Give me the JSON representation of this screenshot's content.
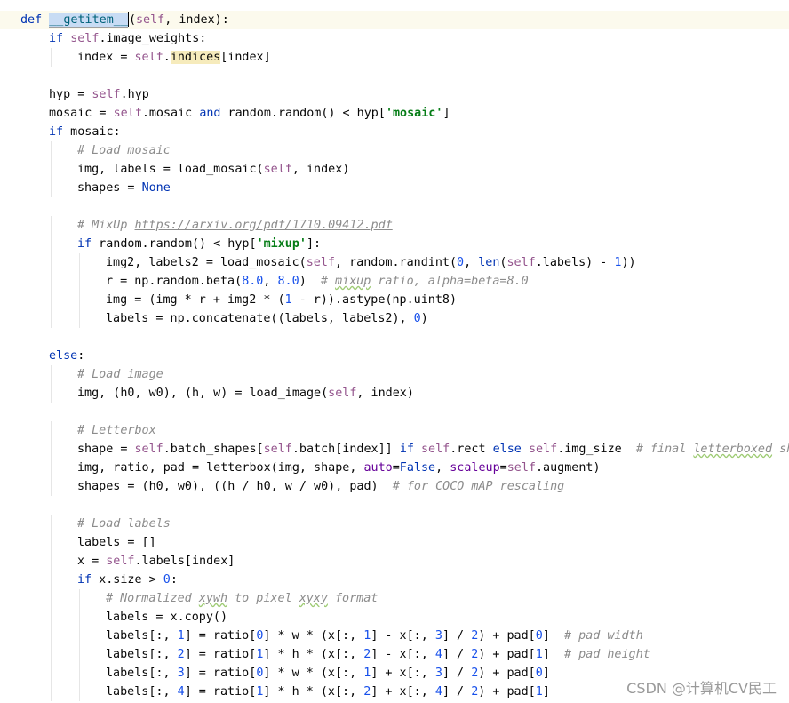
{
  "editor": {
    "lines": [
      [
        {
          "t": "def",
          "c": "kw"
        },
        {
          "t": " "
        },
        {
          "t": "__getitem__",
          "c": "fn-hl"
        },
        {
          "t": "",
          "c": "caret"
        },
        {
          "t": "("
        },
        {
          "t": "self",
          "c": "self"
        },
        {
          "t": ", index):"
        }
      ],
      [
        {
          "t": "if",
          "c": "kw"
        },
        {
          "t": " "
        },
        {
          "t": "self",
          "c": "self"
        },
        {
          "t": ".image_weights:"
        }
      ],
      [
        {
          "t": "index = "
        },
        {
          "t": "self",
          "c": "self"
        },
        {
          "t": "."
        },
        {
          "t": "indices",
          "c": "hl-warn"
        },
        {
          "t": "[index]"
        }
      ],
      [],
      [
        {
          "t": "hyp = "
        },
        {
          "t": "self",
          "c": "self"
        },
        {
          "t": ".hyp"
        }
      ],
      [
        {
          "t": "mosaic = "
        },
        {
          "t": "self",
          "c": "self"
        },
        {
          "t": ".mosaic "
        },
        {
          "t": "and",
          "c": "kw"
        },
        {
          "t": " random.random() < hyp["
        },
        {
          "t": "'mosaic'",
          "c": "str"
        },
        {
          "t": "]"
        }
      ],
      [
        {
          "t": "if",
          "c": "kw"
        },
        {
          "t": " mosaic:"
        }
      ],
      [
        {
          "t": "# Load mosaic",
          "c": "cm"
        }
      ],
      [
        {
          "t": "img, labels = load_mosaic("
        },
        {
          "t": "self",
          "c": "self"
        },
        {
          "t": ", index)"
        }
      ],
      [
        {
          "t": "shapes = "
        },
        {
          "t": "None",
          "c": "kw"
        }
      ],
      [],
      [
        {
          "t": "# MixUp ",
          "c": "cm"
        },
        {
          "t": "https://arxiv.org/pdf/1710.09412.pdf",
          "c": "url"
        }
      ],
      [
        {
          "t": "if",
          "c": "kw"
        },
        {
          "t": " random.random() < hyp["
        },
        {
          "t": "'mixup'",
          "c": "str"
        },
        {
          "t": "]:"
        }
      ],
      [
        {
          "t": "img2, labels2 = load_mosaic("
        },
        {
          "t": "self",
          "c": "self"
        },
        {
          "t": ", random.randint("
        },
        {
          "t": "0",
          "c": "num"
        },
        {
          "t": ", "
        },
        {
          "t": "len",
          "c": "kw"
        },
        {
          "t": "("
        },
        {
          "t": "self",
          "c": "self"
        },
        {
          "t": ".labels) - "
        },
        {
          "t": "1",
          "c": "num"
        },
        {
          "t": "))"
        }
      ],
      [
        {
          "t": "r = np.random.beta("
        },
        {
          "t": "8.0",
          "c": "num"
        },
        {
          "t": ", "
        },
        {
          "t": "8.0",
          "c": "num"
        },
        {
          "t": ")  "
        },
        {
          "t": "# ",
          "c": "cm"
        },
        {
          "t": "mixup",
          "c": "cm typo"
        },
        {
          "t": " ratio, alpha=beta=8.0",
          "c": "cm"
        }
      ],
      [
        {
          "t": "img = (img * r + img2 * ("
        },
        {
          "t": "1",
          "c": "num"
        },
        {
          "t": " - r)).astype(np.uint8)"
        }
      ],
      [
        {
          "t": "labels = np.concatenate((labels, labels2), "
        },
        {
          "t": "0",
          "c": "num"
        },
        {
          "t": ")"
        }
      ],
      [],
      [
        {
          "t": "else",
          "c": "kw"
        },
        {
          "t": ":"
        }
      ],
      [
        {
          "t": "# Load image",
          "c": "cm"
        }
      ],
      [
        {
          "t": "img, (h0, w0), (h, w) = load_image("
        },
        {
          "t": "self",
          "c": "self"
        },
        {
          "t": ", index)"
        }
      ],
      [],
      [
        {
          "t": "# Letterbox",
          "c": "cm"
        }
      ],
      [
        {
          "t": "shape = "
        },
        {
          "t": "self",
          "c": "self"
        },
        {
          "t": ".batch_shapes["
        },
        {
          "t": "self",
          "c": "self"
        },
        {
          "t": ".batch[index]] "
        },
        {
          "t": "if",
          "c": "kw"
        },
        {
          "t": " "
        },
        {
          "t": "self",
          "c": "self"
        },
        {
          "t": ".rect "
        },
        {
          "t": "else",
          "c": "kw"
        },
        {
          "t": " "
        },
        {
          "t": "self",
          "c": "self"
        },
        {
          "t": ".img_size  "
        },
        {
          "t": "# final ",
          "c": "cm"
        },
        {
          "t": "letterboxed",
          "c": "cm typo"
        },
        {
          "t": " sh",
          "c": "cm"
        }
      ],
      [
        {
          "t": "img, ratio, pad = letterbox(img, shape, "
        },
        {
          "t": "auto",
          "c": "kwarg"
        },
        {
          "t": "="
        },
        {
          "t": "False",
          "c": "kw"
        },
        {
          "t": ", "
        },
        {
          "t": "scaleup",
          "c": "kwarg"
        },
        {
          "t": "="
        },
        {
          "t": "self",
          "c": "self"
        },
        {
          "t": ".augment)"
        }
      ],
      [
        {
          "t": "shapes = (h0, w0), ((h / h0, w / w0), pad)  "
        },
        {
          "t": "# for COCO mAP rescaling",
          "c": "cm"
        }
      ],
      [],
      [
        {
          "t": "# Load labels",
          "c": "cm"
        }
      ],
      [
        {
          "t": "labels = []"
        }
      ],
      [
        {
          "t": "x = "
        },
        {
          "t": "self",
          "c": "self"
        },
        {
          "t": ".labels[index]"
        }
      ],
      [
        {
          "t": "if",
          "c": "kw"
        },
        {
          "t": " x.size > "
        },
        {
          "t": "0",
          "c": "num"
        },
        {
          "t": ":"
        }
      ],
      [
        {
          "t": "# Normalized ",
          "c": "cm"
        },
        {
          "t": "xywh",
          "c": "cm typo"
        },
        {
          "t": " to pixel ",
          "c": "cm"
        },
        {
          "t": "xyxy",
          "c": "cm typo"
        },
        {
          "t": " format",
          "c": "cm"
        }
      ],
      [
        {
          "t": "labels = x.copy()"
        }
      ],
      [
        {
          "t": "labels[:, "
        },
        {
          "t": "1",
          "c": "num"
        },
        {
          "t": "] = ratio["
        },
        {
          "t": "0",
          "c": "num"
        },
        {
          "t": "] * w * (x[:, "
        },
        {
          "t": "1",
          "c": "num"
        },
        {
          "t": "] - x[:, "
        },
        {
          "t": "3",
          "c": "num"
        },
        {
          "t": "] / "
        },
        {
          "t": "2",
          "c": "num"
        },
        {
          "t": ") + pad["
        },
        {
          "t": "0",
          "c": "num"
        },
        {
          "t": "]  "
        },
        {
          "t": "# pad width",
          "c": "cm"
        }
      ],
      [
        {
          "t": "labels[:, "
        },
        {
          "t": "2",
          "c": "num"
        },
        {
          "t": "] = ratio["
        },
        {
          "t": "1",
          "c": "num"
        },
        {
          "t": "] * h * (x[:, "
        },
        {
          "t": "2",
          "c": "num"
        },
        {
          "t": "] - x[:, "
        },
        {
          "t": "4",
          "c": "num"
        },
        {
          "t": "] / "
        },
        {
          "t": "2",
          "c": "num"
        },
        {
          "t": ") + pad["
        },
        {
          "t": "1",
          "c": "num"
        },
        {
          "t": "]  "
        },
        {
          "t": "# pad height",
          "c": "cm"
        }
      ],
      [
        {
          "t": "labels[:, "
        },
        {
          "t": "3",
          "c": "num"
        },
        {
          "t": "] = ratio["
        },
        {
          "t": "0",
          "c": "num"
        },
        {
          "t": "] * w * (x[:, "
        },
        {
          "t": "1",
          "c": "num"
        },
        {
          "t": "] + x[:, "
        },
        {
          "t": "3",
          "c": "num"
        },
        {
          "t": "] / "
        },
        {
          "t": "2",
          "c": "num"
        },
        {
          "t": ") + pad["
        },
        {
          "t": "0",
          "c": "num"
        },
        {
          "t": "]"
        }
      ],
      [
        {
          "t": "labels[:, "
        },
        {
          "t": "4",
          "c": "num"
        },
        {
          "t": "] = ratio["
        },
        {
          "t": "1",
          "c": "num"
        },
        {
          "t": "] * h * (x[:, "
        },
        {
          "t": "2",
          "c": "num"
        },
        {
          "t": "] + x[:, "
        },
        {
          "t": "4",
          "c": "num"
        },
        {
          "t": "] / "
        },
        {
          "t": "2",
          "c": "num"
        },
        {
          "t": ") + pad["
        },
        {
          "t": "1",
          "c": "num"
        },
        {
          "t": "]"
        }
      ]
    ]
  },
  "watermark": "CSDN @计算机CV民工"
}
